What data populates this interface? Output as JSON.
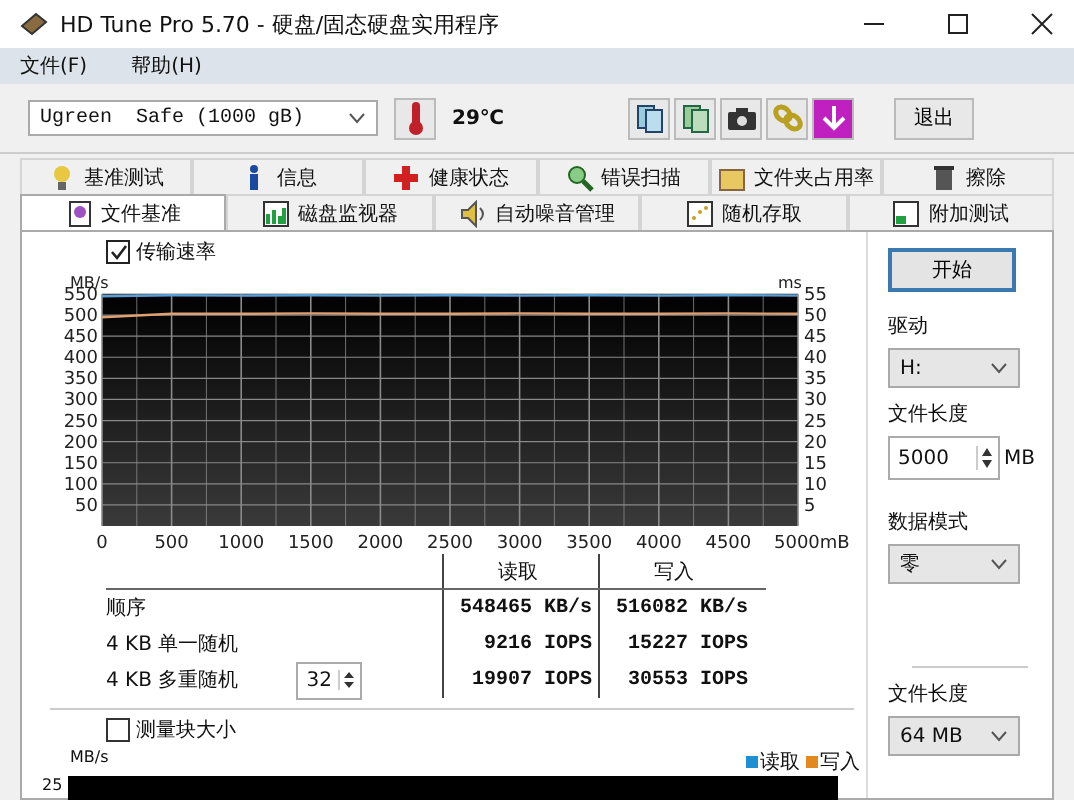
{
  "window": {
    "title": "HD Tune Pro 5.70 - 硬盘/固态硬盘实用程序"
  },
  "menu": [
    {
      "label": "文件(F)"
    },
    {
      "label": "帮助(H)"
    }
  ],
  "toolbar": {
    "drive": "Ugreen  Safe (1000 gB)",
    "temperature": "29℃",
    "exit_button": "退出"
  },
  "tab_rows": [
    [
      {
        "label": "基准测试",
        "selected": false
      },
      {
        "label": "信息",
        "selected": false
      },
      {
        "label": "健康状态",
        "selected": false
      },
      {
        "label": "错误扫描",
        "selected": false
      },
      {
        "label": "文件夹占用率",
        "selected": false
      },
      {
        "label": "擦除",
        "selected": false
      }
    ],
    [
      {
        "label": "文件基准",
        "selected": true
      },
      {
        "label": "磁盘监视器",
        "selected": false
      },
      {
        "label": "自动噪音管理",
        "selected": false
      },
      {
        "label": "随机存取",
        "selected": false
      },
      {
        "label": "附加测试",
        "selected": false
      }
    ]
  ],
  "transfer_rate": {
    "label": "传输速率",
    "checked": true
  },
  "speed_chart": {
    "ylabel_unit": "MB/s",
    "ms_unit": "ms",
    "ms_ticks": [
      "55",
      "50",
      "45",
      "40",
      "35",
      "30",
      "25",
      "20",
      "15",
      "10",
      "5"
    ],
    "chart_data": {
      "type": "line",
      "grid": true,
      "x": [
        0,
        500,
        1000,
        1500,
        2000,
        2500,
        3000,
        3500,
        4000,
        4500,
        5000
      ],
      "xlim": [
        0,
        5000
      ],
      "ylim": [
        0,
        550
      ],
      "xticks": [
        0,
        500,
        1000,
        1500,
        2000,
        2500,
        3000,
        3500,
        4000,
        4500,
        {
          "value": 5000,
          "label": "5000mB"
        }
      ],
      "yticks": [
        50,
        100,
        150,
        200,
        250,
        300,
        350,
        400,
        450,
        500,
        550
      ],
      "series": [
        {
          "color": "#5aa0d8",
          "values": [
            545,
            547,
            546,
            547,
            546,
            547,
            546,
            547,
            546,
            547,
            546
          ]
        },
        {
          "color": "#e0a070",
          "values": [
            495,
            503,
            503,
            504,
            503,
            503,
            504,
            503,
            503,
            504,
            503
          ]
        }
      ]
    }
  },
  "results": {
    "columns": [
      "读取",
      "写入"
    ],
    "queue_depth": "32",
    "rows": [
      {
        "label": "顺序",
        "read": "548465 KB/s",
        "write": "516082 KB/s"
      },
      {
        "label": "4 KB 单一随机",
        "read": "9216 IOPS",
        "write": "15227 IOPS"
      },
      {
        "label": "4 KB 多重随机",
        "read": "19907 IOPS",
        "write": "30553 IOPS"
      }
    ]
  },
  "block_size": {
    "label": "测量块大小",
    "checked": false
  },
  "block_chart": {
    "unit": "MB/s",
    "top_tick": "25",
    "legend": [
      {
        "label": "读取",
        "color": "#1e8fd0"
      },
      {
        "label": "写入",
        "color": "#e08a20"
      }
    ]
  },
  "side": {
    "start_button": "开始",
    "drive_label": "驱动",
    "drive": "H:",
    "file_length_label": "文件长度",
    "file_length": "5000",
    "file_length_unit": "MB",
    "data_mode_label": "数据模式",
    "data_mode": "零",
    "block_file_length_label": "文件长度",
    "block_file_length": "64 MB"
  }
}
